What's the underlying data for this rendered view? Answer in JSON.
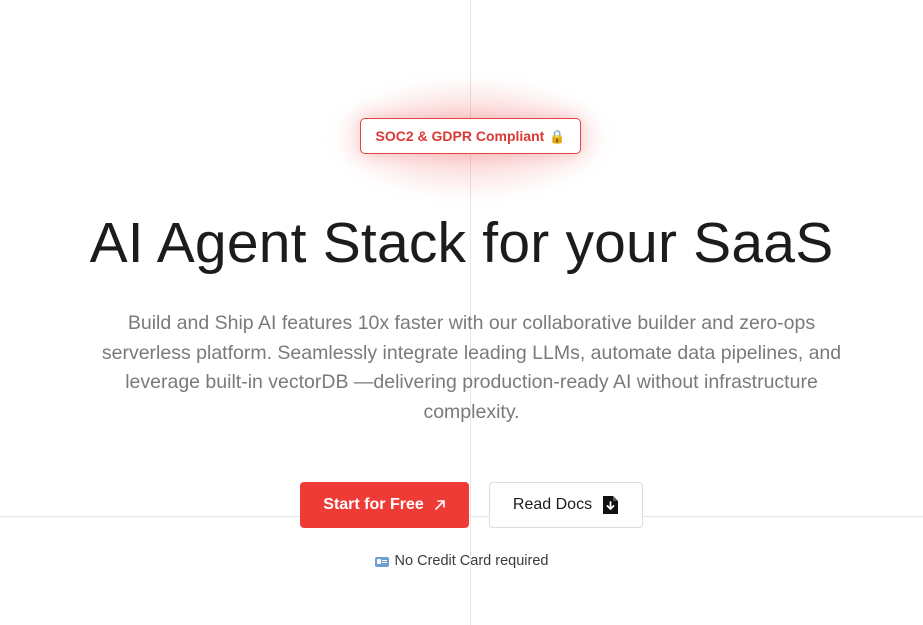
{
  "badge": {
    "text": "SOC2 & GDPR Compliant",
    "icon": "lock-icon",
    "color": "#d93a35"
  },
  "hero": {
    "title": "AI Agent Stack for your SaaS",
    "subtitle": "Build and Ship AI features 10x faster with our collaborative builder and zero-ops serverless platform. Seamlessly integrate leading LLMs, automate data pipelines, and leverage built-in vectorDB —delivering production-ready AI without infrastructure complexity."
  },
  "actions": {
    "primary_label": "Start for Free",
    "primary_icon": "arrow-up-right-icon",
    "primary_color": "#ef3b36",
    "secondary_label": "Read Docs",
    "secondary_icon": "file-download-icon"
  },
  "note": {
    "text": "No Credit Card required",
    "icon": "id-card-icon"
  }
}
